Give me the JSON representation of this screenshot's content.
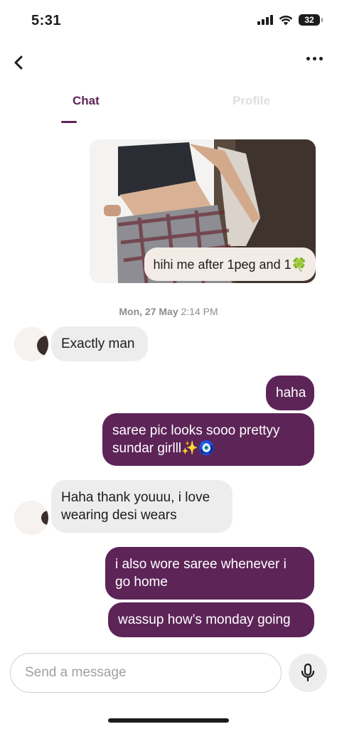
{
  "status_bar": {
    "time": "5:31",
    "battery": "32"
  },
  "nav": {
    "back_icon": "chevron-left-icon",
    "more_icon": "more-horizontal-icon"
  },
  "tabs": [
    {
      "label": "Chat",
      "active": true
    },
    {
      "label": "Profile",
      "active": false
    }
  ],
  "messages": {
    "photo_caption": "hihi me after 1peg and 1🍀",
    "date_day": "Mon, 27 May",
    "date_time": "2:14 PM",
    "m1": "Exactly man",
    "m2": "haha",
    "m3_line1": "saree pic looks sooo prettyy",
    "m3_line2": "sundar girlll✨🧿",
    "m4_line1": "Haha thank youuu, i love",
    "m4_line2": "wearing desi wears",
    "m5_line1": "i also wore saree whenever i",
    "m5_line2": "go home",
    "m6": "wassup how’s monday going"
  },
  "composer": {
    "placeholder": "Send a message",
    "mic_icon": "microphone-icon"
  },
  "colors": {
    "accent": "#5d2458",
    "incoming_bubble": "#ededee",
    "caption_bubble": "#f3ece6"
  }
}
